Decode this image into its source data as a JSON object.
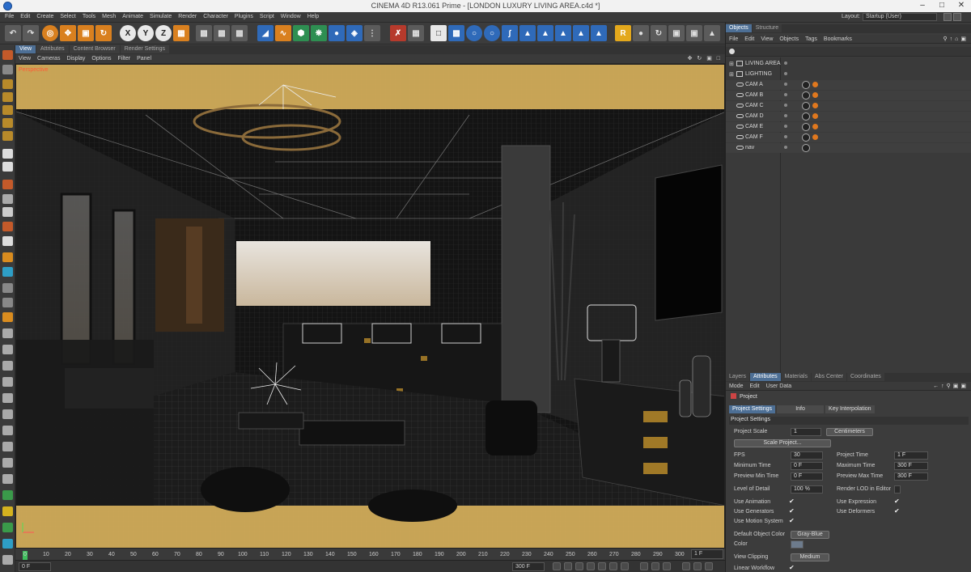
{
  "window": {
    "title": "CINEMA 4D R13.061 Prime - [LONDON LUXURY LIVING AREA.c4d *]",
    "minimize": "–",
    "maximize": "□",
    "close": "✕"
  },
  "menubar": {
    "items": [
      "File",
      "Edit",
      "Create",
      "Select",
      "Tools",
      "Mesh",
      "Animate",
      "Simulate",
      "Render",
      "Character",
      "Plugins",
      "Script",
      "Window",
      "Help"
    ],
    "layout_label": "Layout:",
    "layout_value": "Startup (User)"
  },
  "toolbar": {
    "icons": [
      "undo-icon",
      "redo-icon",
      "live-select-icon",
      "move-icon",
      "scale-icon",
      "rotate-icon",
      "x-axis-icon",
      "y-axis-icon",
      "z-axis-icon",
      "coordinate-system-icon",
      "render-view-icon",
      "render-picture-viewer-icon",
      "edit-render-settings-icon",
      "cube-icon",
      "spline-pen-icon",
      "subdivision-surface-icon",
      "array-icon",
      "deformer-icon",
      "light-icon",
      "camera-icon",
      "scene-icon"
    ],
    "axis_labels": {
      "x": "X",
      "y": "Y",
      "z": "Z"
    }
  },
  "viewport": {
    "tabs": [
      "View",
      "Attributes",
      "Content Browser",
      "Render Settings"
    ],
    "menu": [
      "View",
      "Cameras",
      "Display",
      "Options",
      "Filter",
      "Panel"
    ],
    "view_label": "Perspective",
    "nav_controls": "✥ ↻ ▣ □"
  },
  "timeline": {
    "ticks": [
      "0",
      "10",
      "20",
      "30",
      "40",
      "50",
      "60",
      "70",
      "80",
      "90",
      "100",
      "110",
      "120",
      "130",
      "140",
      "150",
      "160",
      "170",
      "180",
      "190",
      "200",
      "210",
      "220",
      "230",
      "240",
      "250",
      "260",
      "270",
      "280",
      "290",
      "300"
    ],
    "current_frame": "1 F",
    "start_frame": "0 F",
    "end_frame": "300 F"
  },
  "objects_panel": {
    "tabs": [
      "Objects",
      "Structure"
    ],
    "menu": [
      "File",
      "Edit",
      "View",
      "Objects",
      "Tags",
      "Bookmarks"
    ],
    "items": [
      {
        "name": "LIVING AREA",
        "type": "layer"
      },
      {
        "name": "LIGHTING",
        "type": "layer"
      },
      {
        "name": "CAM A",
        "type": "camera"
      },
      {
        "name": "CAM B",
        "type": "camera"
      },
      {
        "name": "CAM C",
        "type": "camera"
      },
      {
        "name": "CAM D",
        "type": "camera"
      },
      {
        "name": "CAM E",
        "type": "camera"
      },
      {
        "name": "CAM F",
        "type": "camera"
      },
      {
        "name": "nav",
        "type": "camera"
      }
    ]
  },
  "attributes_panel": {
    "tabs": [
      "Layers",
      "Attributes",
      "Materials",
      "Abs Center",
      "Coordinates"
    ],
    "menu": [
      "Mode",
      "Edit",
      "User Data"
    ],
    "object_name": "Project",
    "subtabs": [
      "Project Settings",
      "Info",
      "Key Interpolation"
    ],
    "section": "Project Settings",
    "project_scale_label": "Project Scale",
    "project_scale_value": "1",
    "project_scale_unit": "Centimeters",
    "scale_project_button": "Scale Project...",
    "fps_label": "FPS",
    "fps_value": "30",
    "project_time_label": "Project Time",
    "project_time_value": "1 F",
    "min_time_label": "Minimum Time",
    "min_time_value": "0 F",
    "max_time_label": "Maximum Time",
    "max_time_value": "300 F",
    "preview_min_label": "Preview Min Time",
    "preview_min_value": "0 F",
    "preview_max_label": "Preview Max Time",
    "preview_max_value": "300 F",
    "lod_label": "Level of Detail",
    "lod_value": "100 %",
    "render_lod_label": "Render LOD in Editor",
    "use_animation_label": "Use Animation",
    "use_expression_label": "Use Expression",
    "use_generators_label": "Use Generators",
    "use_deformers_label": "Use Deformers",
    "use_motion_label": "Use Motion System",
    "default_color_label": "Default Object Color",
    "default_color_value": "Gray-Blue",
    "color_label": "Color",
    "view_clipping_label": "View Clipping",
    "view_clipping_value": "Medium",
    "linear_workflow_label": "Linear Workflow",
    "checkmark": "✔"
  },
  "colors": {
    "accent": "#4d6f95",
    "viewport_border": "#e2b655",
    "timeline_playhead": "#3fbf5d",
    "perspective_label": "#ff5a36"
  }
}
